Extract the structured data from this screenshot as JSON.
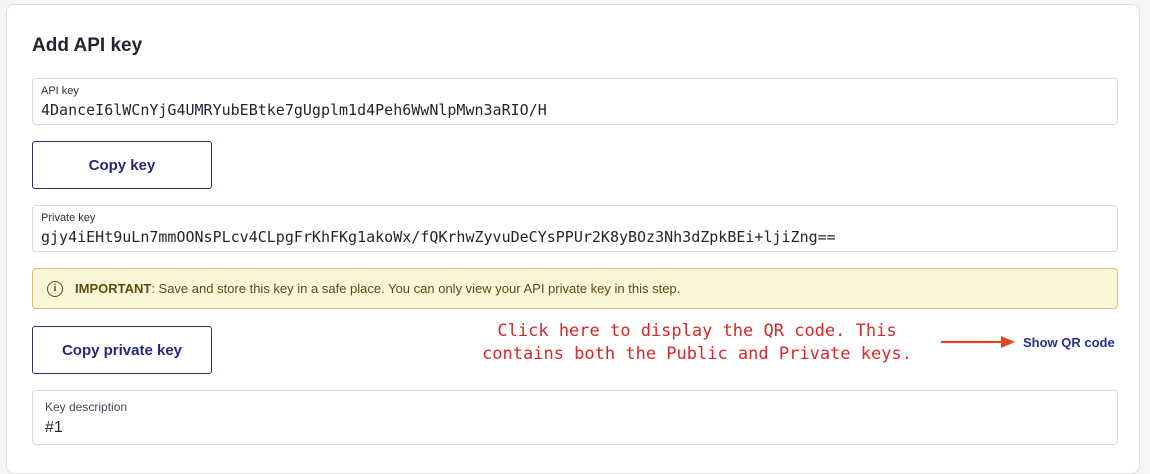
{
  "header": {
    "title": "Add API key"
  },
  "api_key": {
    "label": "API key",
    "value": "4DanceI6lWCnYjG4UMRYubEBtke7gUgplm1d4Peh6WwNlpMwn3aRIO/H",
    "copy_button_label": "Copy key"
  },
  "private_key": {
    "label": "Private key",
    "value": "gjy4iEHt9uLn7mmOONsPLcv4CLpgFrKhFKg1akoWx/fQKrhwZyvuDeCYsPPUr2K8yBOz3Nh3dZpkBEi+ljiZng==",
    "copy_button_label": "Copy private key"
  },
  "notice": {
    "icon": "info-circle-icon",
    "strong": "IMPORTANT",
    "text": ": Save and store this key in a safe place. You can only view your API private key in this step."
  },
  "annotation": {
    "line1": "Click here to display the QR code. This",
    "line2": "contains both the Public and Private keys.",
    "color": "#d62828"
  },
  "qr": {
    "link_label": "Show QR code"
  },
  "description": {
    "label": "Key description",
    "value": "#1"
  }
}
